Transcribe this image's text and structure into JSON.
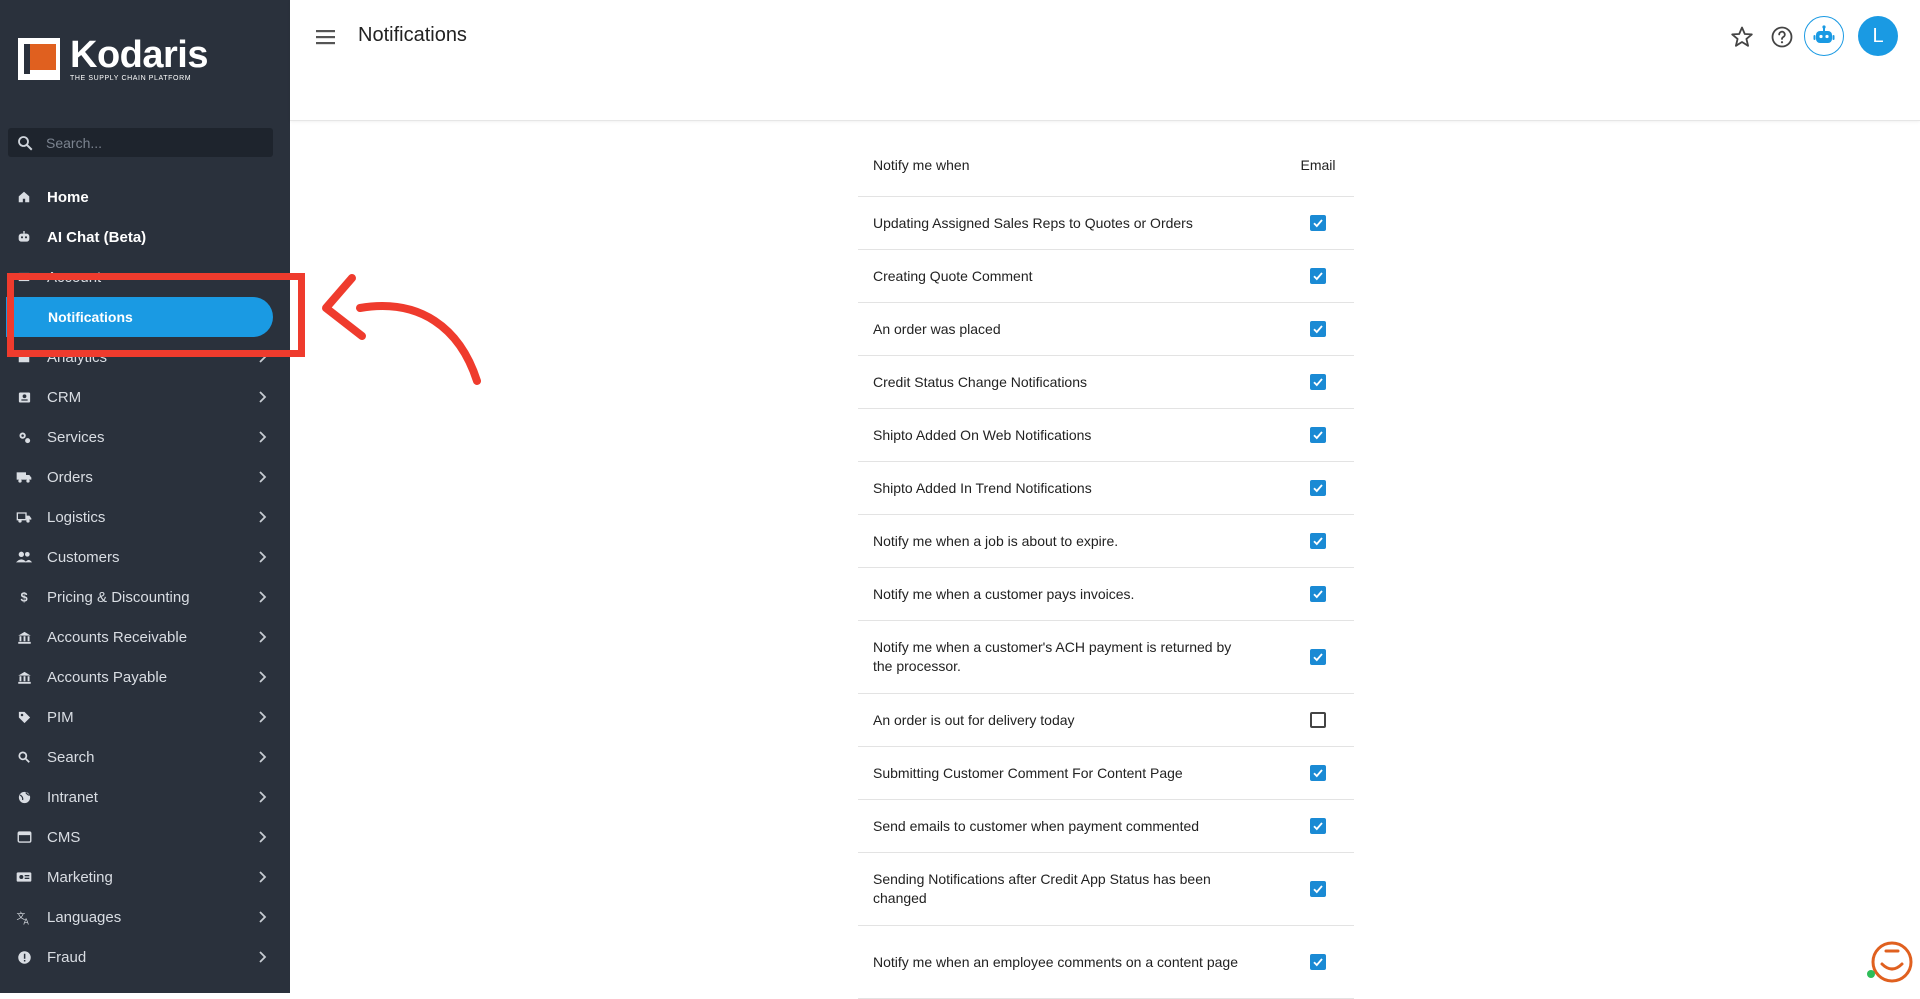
{
  "app": {
    "logo_name": "Kodaris",
    "logo_tagline": "THE SUPPLY CHAIN PLATFORM",
    "page_title": "Notifications",
    "accent_color": "#1a9ae3",
    "annotation_color": "#ef3b2d"
  },
  "sidebar": {
    "search_placeholder": "Search...",
    "items": [
      {
        "label": "Home",
        "icon": "home-icon"
      },
      {
        "label": "AI Chat (Beta)",
        "icon": "robot-icon"
      },
      {
        "label": "Account",
        "icon": "account-icon"
      },
      {
        "label": "Notifications",
        "icon": "",
        "active": true
      },
      {
        "label": "Analytics",
        "icon": "chart-icon"
      },
      {
        "label": "CRM",
        "icon": "contact-card-icon"
      },
      {
        "label": "Services",
        "icon": "gears-icon"
      },
      {
        "label": "Orders",
        "icon": "truck-icon"
      },
      {
        "label": "Logistics",
        "icon": "delivery-truck-icon"
      },
      {
        "label": "Customers",
        "icon": "people-icon"
      },
      {
        "label": "Pricing & Discounting",
        "icon": "dollar-icon"
      },
      {
        "label": "Accounts Receivable",
        "icon": "bank-icon"
      },
      {
        "label": "Accounts Payable",
        "icon": "bank-icon"
      },
      {
        "label": "PIM",
        "icon": "tag-icon"
      },
      {
        "label": "Search",
        "icon": "search-icon"
      },
      {
        "label": "Intranet",
        "icon": "globe-icon"
      },
      {
        "label": "CMS",
        "icon": "browser-icon"
      },
      {
        "label": "Marketing",
        "icon": "megaphone-icon"
      },
      {
        "label": "Languages",
        "icon": "translate-icon"
      },
      {
        "label": "Fraud",
        "icon": "alert-icon"
      }
    ]
  },
  "header": {
    "avatar_initial": "L"
  },
  "table": {
    "col_event": "Notify me when",
    "col_email": "Email",
    "rows": [
      {
        "label": "Updating Assigned Sales Reps to Quotes or Orders",
        "email": true
      },
      {
        "label": "Creating Quote Comment",
        "email": true
      },
      {
        "label": "An order was placed",
        "email": true
      },
      {
        "label": "Credit Status Change Notifications",
        "email": true
      },
      {
        "label": "Shipto Added On Web Notifications",
        "email": true
      },
      {
        "label": "Shipto Added In Trend Notifications",
        "email": true
      },
      {
        "label": "Notify me when a job is about to expire.",
        "email": true
      },
      {
        "label": "Notify me when a customer pays invoices.",
        "email": true
      },
      {
        "label": "Notify me when a customer's ACH payment is returned by the processor.",
        "email": true
      },
      {
        "label": "An order is out for delivery today",
        "email": false
      },
      {
        "label": "Submitting Customer Comment For Content Page",
        "email": true
      },
      {
        "label": "Send emails to customer when payment commented",
        "email": true
      },
      {
        "label": "Sending Notifications after Credit App Status has been changed",
        "email": true
      },
      {
        "label": "Notify me when an employee comments on a content page",
        "email": true
      }
    ]
  }
}
